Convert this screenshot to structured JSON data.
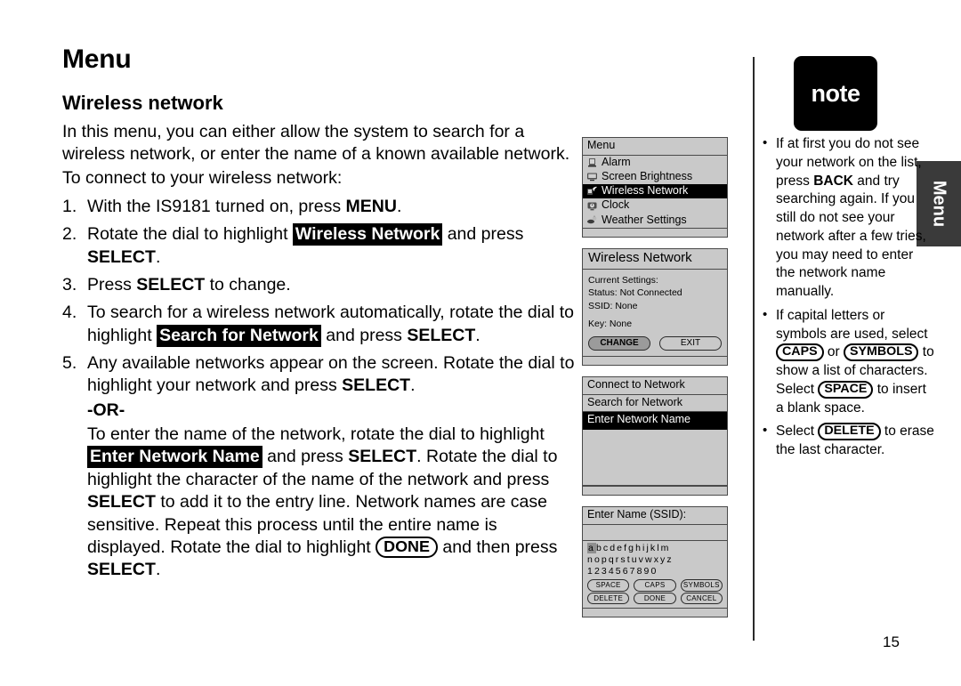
{
  "page": {
    "title": "Menu",
    "section_title": "Wireless network",
    "number": "15"
  },
  "intro": {
    "p1": "In this menu, you can either allow the system to search for a wireless network, or enter the name of a known available network.",
    "p2": "To connect to your wireless network:"
  },
  "steps": {
    "s1_a": "With the IS9181 turned on, press ",
    "s1_b": "MENU",
    "s1_c": ".",
    "s2_a": "Rotate the dial to highlight ",
    "s2_hl": "Wireless Network",
    "s2_b": " and press ",
    "s2_c": "SELECT",
    "s2_d": ".",
    "s3_a": "Press ",
    "s3_b": "SELECT",
    "s3_c": " to change.",
    "s4_a": "To search for a wireless network automatically, rotate the dial to highlight ",
    "s4_hl": "Search for Network",
    "s4_b": " and press ",
    "s4_c": "SELECT",
    "s4_d": ".",
    "s5_a": "Any available networks appear on the screen. Rotate the dial to highlight your network and press ",
    "s5_b": "SELECT",
    "s5_c": ".",
    "or": "-OR-",
    "alt_a": "To enter the name of the network, rotate the dial to highlight ",
    "alt_hl": "Enter Network Name",
    "alt_b": " and press ",
    "alt_c": "SELECT",
    "alt_d": ". Rotate the dial to highlight the character of the name of the network and press ",
    "alt_e": "SELECT",
    "alt_f": " to add it to the entry line. Network names are case sensitive. Repeat this process until the entire name is displayed. Rotate the dial to highlight ",
    "alt_pill": "DONE",
    "alt_g": " and then press ",
    "alt_h": "SELECT",
    "alt_i": "."
  },
  "screens": [
    {
      "id": "menu-screen",
      "title": "Menu",
      "items": [
        {
          "label": "Alarm",
          "icon": "alarm-clock-icon",
          "selected": false
        },
        {
          "label": "Screen Brightness",
          "icon": "screen-icon",
          "selected": false
        },
        {
          "label": "Wireless Network",
          "icon": "wireless-icon",
          "selected": true
        },
        {
          "label": "Clock",
          "icon": "clock-icon",
          "selected": false
        },
        {
          "label": "Weather Settings",
          "icon": "weather-icon",
          "selected": false
        }
      ]
    },
    {
      "id": "wireless-network-screen",
      "title": "Wireless Network",
      "lines": [
        "Current Settings:",
        "Status: Not Connected",
        "SSID: None"
      ],
      "key_line": "Key: None",
      "buttons": [
        {
          "label": "CHANGE",
          "active": true
        },
        {
          "label": "EXIT",
          "active": false
        }
      ]
    },
    {
      "id": "connect-to-network-screen",
      "title": "Connect to Network",
      "items": [
        {
          "label": "Search for Network",
          "selected": false
        },
        {
          "label": "Enter Network Name",
          "selected": true
        }
      ]
    },
    {
      "id": "enter-name-screen",
      "title": "Enter Name (SSID):",
      "keyboard_rows": [
        {
          "selected_char": "a",
          "rest": "bcdefghijklm"
        },
        {
          "selected_char": "",
          "rest": "nopqrstuvwxyz"
        },
        {
          "selected_char": "",
          "rest": "1234567890"
        }
      ],
      "buttons_row1": [
        "SPACE",
        "CAPS",
        "SYMBOLS"
      ],
      "buttons_row2": [
        "DELETE",
        "DONE",
        "CANCEL"
      ]
    }
  ],
  "note": {
    "badge": "note",
    "side_tab": "Menu",
    "items": [
      {
        "a": "If at first you do not see your network on the list, press ",
        "bold": "BACK",
        "b": " and try searching again. If you still do not see your network after a few tries, you may need to enter the network name manually.",
        "pills": []
      },
      {
        "a": "If capital letters or symbols are used, select ",
        "pill1": "CAPS",
        "b": " or ",
        "pill2": "SYMBOLS",
        "c": " to show a list of characters. Select ",
        "pill3": "SPACE",
        "d": " to insert a blank space."
      },
      {
        "a": "Select ",
        "pill1": "DELETE",
        "b": " to erase the last character."
      }
    ]
  }
}
